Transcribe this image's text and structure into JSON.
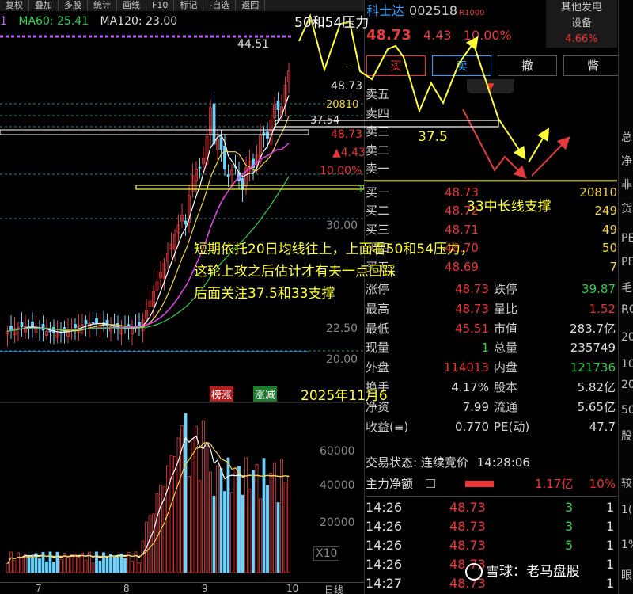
{
  "toolbar": [
    "复权",
    "叠加",
    "多股",
    "统计",
    "画线",
    "F10",
    "标记",
    "-自选",
    "返回"
  ],
  "ma": [
    {
      "label": "1",
      "color": "#c060ff"
    },
    {
      "label": "MA60: 25.41",
      "color": "#2bd14a"
    },
    {
      "label": "MA120: 23.00",
      "color": "#dddddd"
    }
  ],
  "price_labels": {
    "high_mark": "44.51",
    "p1": "48.73",
    "p2": "--",
    "p3": "20810",
    "p4": "37.54",
    "p5": "48.73",
    "p6": "▲4.43",
    "p7": "10.00%",
    "p8": "1",
    "lv30": "30.00",
    "lv2250": "22.50",
    "lv20": "20.00",
    "vol60k": "60000",
    "vol40k": "40000",
    "vol20k": "20000",
    "x10": "X10"
  },
  "flags": {
    "up": "榜涨",
    "down": "涨减"
  },
  "stock": {
    "name": "科士达",
    "code": "002518",
    "tag": "R1000",
    "price": "48.73",
    "change": "4.43",
    "pct": "10.00%"
  },
  "sector": {
    "name1": "其他发电",
    "name2": "设备",
    "change": "4.66%"
  },
  "buttons": [
    "买",
    "卖",
    "撤",
    "瞥"
  ],
  "orderbook": {
    "asks": [
      {
        "label": "卖五",
        "price": "",
        "vol": ""
      },
      {
        "label": "卖四",
        "price": "",
        "vol": ""
      },
      {
        "label": "卖三",
        "price": "",
        "vol": ""
      },
      {
        "label": "卖二",
        "price": "",
        "vol": ""
      },
      {
        "label": "卖一",
        "price": "",
        "vol": ""
      }
    ],
    "bids": [
      {
        "label": "买一",
        "price": "48.73",
        "vol": "20810"
      },
      {
        "label": "买二",
        "price": "48.72",
        "vol": "249"
      },
      {
        "label": "买三",
        "price": "48.71",
        "vol": "49"
      },
      {
        "label": "买四",
        "price": "48.70",
        "vol": "50"
      },
      {
        "label": "买五",
        "price": "48.69",
        "vol": "7"
      }
    ]
  },
  "stats": [
    {
      "k1": "涨停",
      "v1": "48.73",
      "c1": "red",
      "k2": "跌停",
      "v2": "39.87",
      "c2": "grn"
    },
    {
      "k1": "最高",
      "v1": "48.73",
      "c1": "red",
      "k2": "量比",
      "v2": "1.52",
      "c2": "red"
    },
    {
      "k1": "最低",
      "v1": "45.51",
      "c1": "red",
      "k2": "市值",
      "v2": "283.7亿",
      "c2": "wht"
    },
    {
      "k1": "现量",
      "v1": "1",
      "c1": "grn",
      "k2": "总量",
      "v2": "235749",
      "c2": "wht"
    },
    {
      "k1": "外盘",
      "v1": "114013",
      "c1": "red",
      "k2": "内盘",
      "v2": "121736",
      "c2": "grn"
    },
    {
      "k1": "换手",
      "v1": "4.17%",
      "c1": "wht",
      "k2": "股本",
      "v2": "5.82亿",
      "c2": "wht"
    },
    {
      "k1": "净资",
      "v1": "7.99",
      "c1": "wht",
      "k2": "流通",
      "v2": "5.65亿",
      "c2": "wht"
    },
    {
      "k1": "收益(≡)",
      "v1": "0.770",
      "c1": "wht",
      "k2": "PE(动)",
      "v2": "47.7",
      "c2": "wht"
    }
  ],
  "trade_status": {
    "label": "交易状态: 连续竞价",
    "time": "14:28:06"
  },
  "main_flow": {
    "label": "主力净额",
    "value": "1.17亿",
    "pct": "10%"
  },
  "ticks": [
    {
      "time": "14:26",
      "price": "48.73",
      "vol": "3",
      "n": "1"
    },
    {
      "time": "14:26",
      "price": "48.73",
      "vol": "3",
      "n": "1"
    },
    {
      "time": "14:26",
      "price": "48.73",
      "vol": "5",
      "n": "1"
    },
    {
      "time": "14:26",
      "price": "48.73",
      "vol": "",
      "n": "1"
    },
    {
      "time": "14:27",
      "price": "48.73",
      "vol": "",
      "n": "1"
    }
  ],
  "axis": {
    "m7": "7",
    "m8": "8",
    "m9": "9",
    "m10": "10",
    "period": "日线"
  },
  "annotations": {
    "pressure": "50和54压力",
    "level375": "37.5",
    "support33": "33中长线支撑",
    "line1": "短期依托20日均线往上，上面看50和54压力，",
    "line2": "这轮上攻之后估计才有夫一点回踩",
    "line3": "后面关注37.5和33支撑",
    "date": "2025年11月6"
  },
  "watermark": "雪球：老马盘股",
  "far_right": [
    "总",
    "净",
    "非",
    "货",
    "PE",
    "PE",
    "毛",
    "RO",
    "20",
    "10",
    "20",
    "50",
    "股",
    "较",
    "1(",
    "1%",
    "眼"
  ],
  "colors": {
    "up": "#e33b3b",
    "down": "#2bd14a",
    "blue": "#2aa0ff",
    "yellow": "#f2d13b",
    "annotation": "#ffff33"
  }
}
